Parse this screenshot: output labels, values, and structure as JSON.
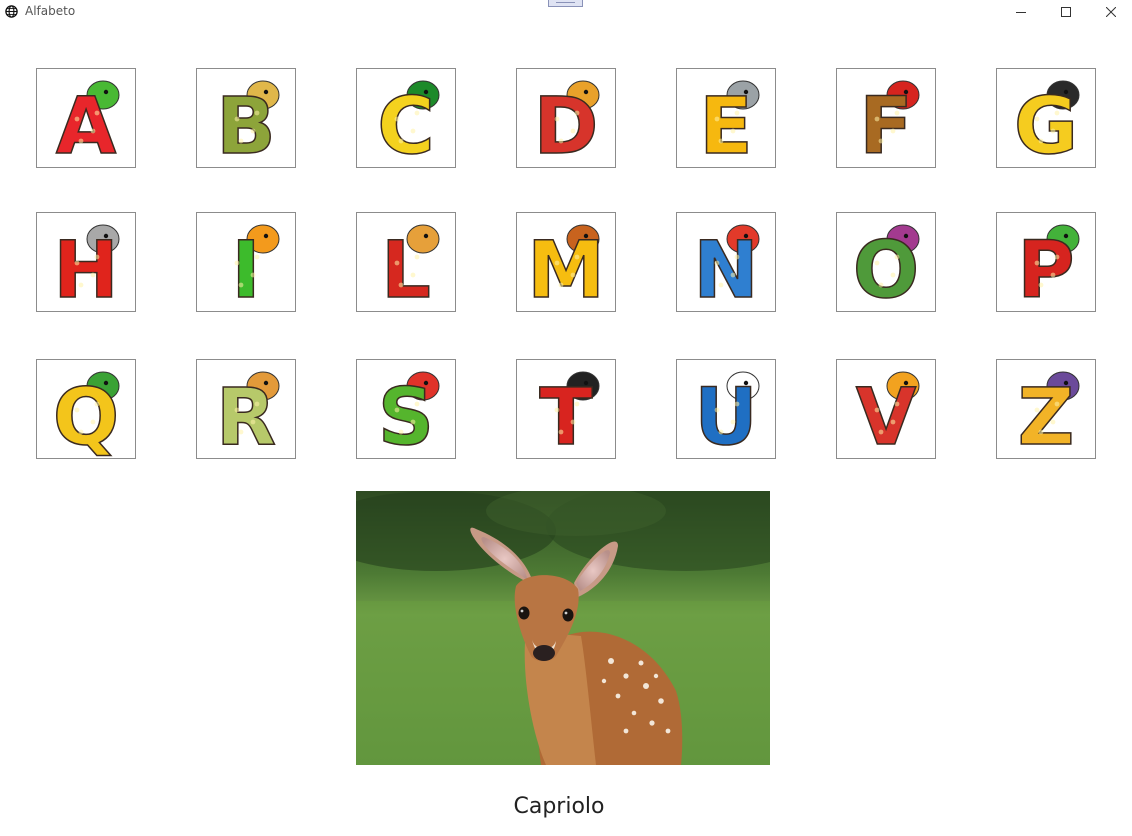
{
  "window": {
    "title": "Alfabeto",
    "icon": "globe-icon",
    "controls": [
      "minimize-icon",
      "maximize-icon",
      "close-icon"
    ]
  },
  "letters": [
    {
      "letter": "A",
      "color": "#e8262b",
      "accent": "#49b934",
      "mascot": "crocodile"
    },
    {
      "letter": "B",
      "color": "#8da43a",
      "accent": "#e0b74a",
      "mascot": "gnome"
    },
    {
      "letter": "C",
      "color": "#f4d21e",
      "accent": "#1d8a2a",
      "mascot": "caterpillar"
    },
    {
      "letter": "D",
      "color": "#d7342b",
      "accent": "#e9a12a",
      "mascot": "gnome"
    },
    {
      "letter": "E",
      "color": "#f6b80f",
      "accent": "#9ba2a6",
      "mascot": "elephant"
    },
    {
      "letter": "F",
      "color": "#a86a22",
      "accent": "#d6241f",
      "mascot": "bow"
    },
    {
      "letter": "G",
      "color": "#f5cc1f",
      "accent": "#2a2a2a",
      "mascot": "clown"
    },
    {
      "letter": "H",
      "color": "#e0241c",
      "accent": "#a8a8a8",
      "mascot": "hippo"
    },
    {
      "letter": "I",
      "color": "#3dbb2c",
      "accent": "#f39a1c",
      "mascot": "crocodile"
    },
    {
      "letter": "L",
      "color": "#d6281f",
      "accent": "#e6a03a",
      "mascot": "lion"
    },
    {
      "letter": "M",
      "color": "#f6bd10",
      "accent": "#c8631e",
      "mascot": "beaver"
    },
    {
      "letter": "N",
      "color": "#2f7fd0",
      "accent": "#e23a2a",
      "mascot": "clown"
    },
    {
      "letter": "O",
      "color": "#4f9a3a",
      "accent": "#a33a8f",
      "mascot": "flowers"
    },
    {
      "letter": "P",
      "color": "#d6241f",
      "accent": "#43b23a",
      "mascot": "frog"
    },
    {
      "letter": "Q",
      "color": "#f3c51b",
      "accent": "#3aa235",
      "mascot": "parrot"
    },
    {
      "letter": "R",
      "color": "#b7c96a",
      "accent": "#e39a3a",
      "mascot": "gnome"
    },
    {
      "letter": "S",
      "color": "#55b52d",
      "accent": "#e0332a",
      "mascot": "parrot"
    },
    {
      "letter": "T",
      "color": "#d8241f",
      "accent": "#222222",
      "mascot": "toucan"
    },
    {
      "letter": "U",
      "color": "#1f6fc3",
      "accent": "#ffffff",
      "mascot": "bird"
    },
    {
      "letter": "V",
      "color": "#d8342b",
      "accent": "#f2a21f",
      "mascot": "gnome"
    },
    {
      "letter": "Z",
      "color": "#f2b327",
      "accent": "#6b4a9a",
      "mascot": "gnome"
    }
  ],
  "photo": {
    "subject": "deer",
    "caption": "Capriolo"
  }
}
